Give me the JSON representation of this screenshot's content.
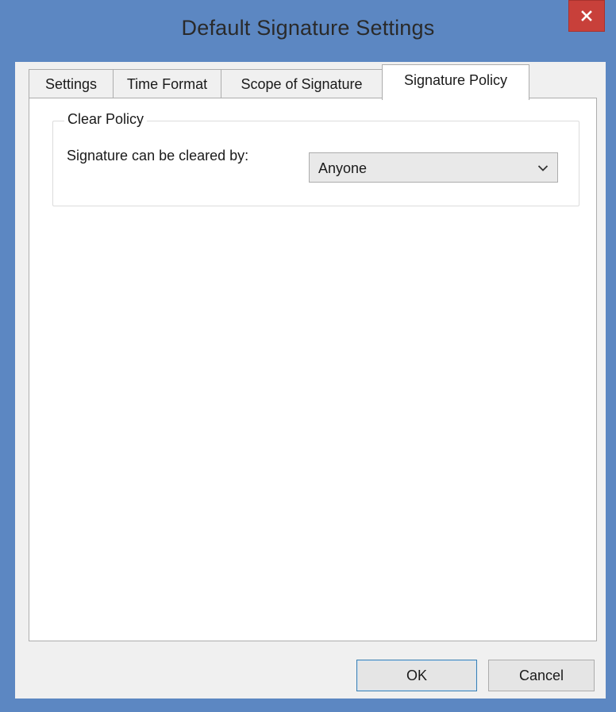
{
  "window": {
    "title": "Default Signature Settings"
  },
  "tabs": [
    {
      "label": "Settings",
      "active": false
    },
    {
      "label": "Time Format",
      "active": false
    },
    {
      "label": "Scope of Signature",
      "active": false
    },
    {
      "label": "Signature Policy",
      "active": true
    }
  ],
  "clear_policy": {
    "group_title": "Clear Policy",
    "field_label": "Signature can be cleared by:",
    "selected_value": "Anyone"
  },
  "buttons": {
    "ok_label": "OK",
    "cancel_label": "Cancel"
  },
  "colors": {
    "frame": "#5c87c2",
    "close_button": "#c8403a",
    "client_background": "#f0f0f0",
    "panel_background": "#ffffff"
  },
  "icons": {
    "close": "close-icon",
    "dropdown": "chevron-down-icon"
  }
}
